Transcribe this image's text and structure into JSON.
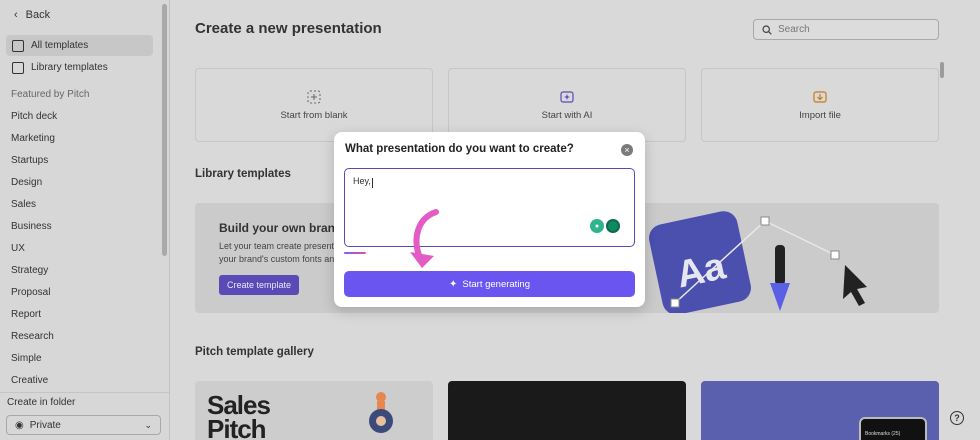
{
  "sidebar": {
    "back_label": "Back",
    "nav": [
      {
        "label": "All templates",
        "active": true
      },
      {
        "label": "Library templates",
        "active": false
      }
    ],
    "featured_heading": "Featured by Pitch",
    "categories": [
      "Pitch deck",
      "Marketing",
      "Startups",
      "Design",
      "Sales",
      "Business",
      "UX",
      "Strategy",
      "Proposal",
      "Report",
      "Research",
      "Simple",
      "Creative"
    ],
    "create_in_folder": "Create in folder",
    "folder_value": "Private"
  },
  "main": {
    "title": "Create a new presentation",
    "search_placeholder": "Search",
    "cards": [
      {
        "label": "Start from blank",
        "icon": "dashed-plus-icon"
      },
      {
        "label": "Start with AI",
        "icon": "ai-sparkle-icon"
      },
      {
        "label": "Import file",
        "icon": "import-icon"
      }
    ],
    "library_heading": "Library templates",
    "banner": {
      "heading": "Build your own brand",
      "text_line1": "Let your team create presentat",
      "text_line2": "your brand's custom fonts and",
      "button": "Create template",
      "art_text": "Aa"
    },
    "gallery_heading": "Pitch template gallery",
    "gallery": {
      "card1_text_line1": "Sales",
      "card1_text_line2": "Pitch",
      "card3_small_text": "Bookmarks (25)"
    },
    "help": "?"
  },
  "modal": {
    "title": "What presentation do you want to create?",
    "close": "×",
    "prompt_value": "Hey, ",
    "generate_label": "Start generating"
  },
  "colors": {
    "accent": "#6a55f0",
    "banner_button": "#5a4ab5",
    "grammarly": "#0e8a5f"
  }
}
